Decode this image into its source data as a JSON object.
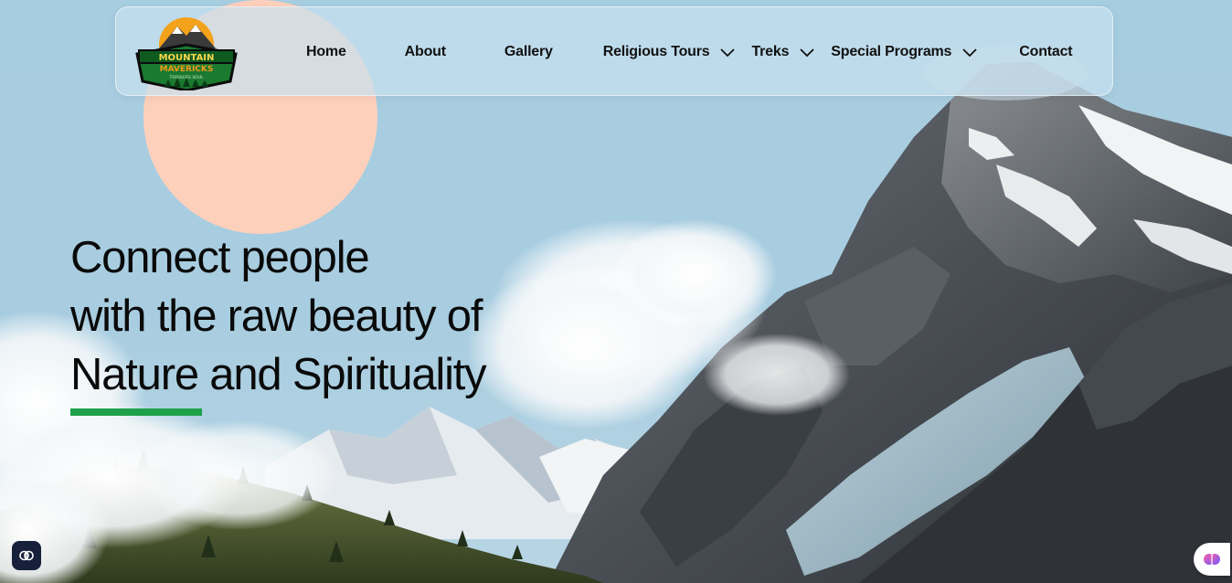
{
  "brand": {
    "logo_line1": "MOUNTAIN",
    "logo_line2": "MAVERICKS",
    "logo_line3": "TREKKERS SOUL"
  },
  "nav": {
    "items": [
      {
        "label": "Home",
        "dropdown": false
      },
      {
        "label": "About",
        "dropdown": false
      },
      {
        "label": "Gallery",
        "dropdown": false
      },
      {
        "label": "Religious Tours",
        "dropdown": true
      },
      {
        "label": "Treks",
        "dropdown": true
      },
      {
        "label": "Special Programs",
        "dropdown": true
      },
      {
        "label": "Contact",
        "dropdown": false
      }
    ]
  },
  "hero": {
    "line1": "Connect people",
    "line2": "with the raw beauty of",
    "line3": "Nature and Spirituality"
  },
  "colors": {
    "sky": "#a9cde0",
    "accent_green": "#1fa14a",
    "peach": "#fdd0bc",
    "text": "#0a0a0a"
  },
  "widgets": {
    "left_icon": "brain-icon",
    "right_icon": "brain-gradient-icon"
  }
}
